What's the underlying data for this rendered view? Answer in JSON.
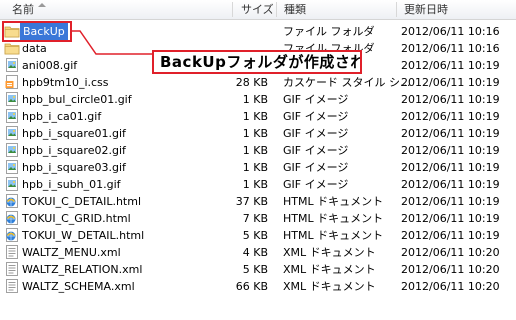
{
  "header": {
    "name": "名前",
    "size": "サイズ",
    "type": "種類",
    "modified": "更新日時"
  },
  "annotation": {
    "text": "BackUpフォルダが作成される",
    "color": "#e0202a"
  },
  "files": [
    {
      "name": "BackUp",
      "size": "",
      "type": "ファイル フォルダ",
      "modified": "2012/06/11 10:16",
      "icon": "folder-icon",
      "selected": true
    },
    {
      "name": "data",
      "size": "",
      "type": "ファイル フォルダ",
      "modified": "2012/06/11 10:16",
      "icon": "folder-icon"
    },
    {
      "name": "ani008.gif",
      "size": "",
      "type": "",
      "modified": "2012/06/11 10:19",
      "icon": "gif-image-icon"
    },
    {
      "name": "hpb9tm10_i.css",
      "size": "28 KB",
      "type": "カスケード スタイル シ...",
      "modified": "2012/06/11 10:19",
      "icon": "css-file-icon"
    },
    {
      "name": "hpb_bul_circle01.gif",
      "size": "1 KB",
      "type": "GIF イメージ",
      "modified": "2012/06/11 10:19",
      "icon": "gif-image-icon"
    },
    {
      "name": "hpb_i_ca01.gif",
      "size": "1 KB",
      "type": "GIF イメージ",
      "modified": "2012/06/11 10:19",
      "icon": "gif-image-icon"
    },
    {
      "name": "hpb_i_square01.gif",
      "size": "1 KB",
      "type": "GIF イメージ",
      "modified": "2012/06/11 10:19",
      "icon": "gif-image-icon"
    },
    {
      "name": "hpb_i_square02.gif",
      "size": "1 KB",
      "type": "GIF イメージ",
      "modified": "2012/06/11 10:19",
      "icon": "gif-image-icon"
    },
    {
      "name": "hpb_i_square03.gif",
      "size": "1 KB",
      "type": "GIF イメージ",
      "modified": "2012/06/11 10:19",
      "icon": "gif-image-icon"
    },
    {
      "name": "hpb_i_subh_01.gif",
      "size": "1 KB",
      "type": "GIF イメージ",
      "modified": "2012/06/11 10:19",
      "icon": "gif-image-icon"
    },
    {
      "name": "TOKUI_C_DETAIL.html",
      "size": "37 KB",
      "type": "HTML ドキュメント",
      "modified": "2012/06/11 10:19",
      "icon": "html-document-icon"
    },
    {
      "name": "TOKUI_C_GRID.html",
      "size": "7 KB",
      "type": "HTML ドキュメント",
      "modified": "2012/06/11 10:19",
      "icon": "html-document-icon"
    },
    {
      "name": "TOKUI_W_DETAIL.html",
      "size": "5 KB",
      "type": "HTML ドキュメント",
      "modified": "2012/06/11 10:19",
      "icon": "html-document-icon"
    },
    {
      "name": "WALTZ_MENU.xml",
      "size": "4 KB",
      "type": "XML ドキュメント",
      "modified": "2012/06/11 10:20",
      "icon": "xml-document-icon"
    },
    {
      "name": "WALTZ_RELATION.xml",
      "size": "5 KB",
      "type": "XML ドキュメント",
      "modified": "2012/06/11 10:20",
      "icon": "xml-document-icon"
    },
    {
      "name": "WALTZ_SCHEMA.xml",
      "size": "66 KB",
      "type": "XML ドキュメント",
      "modified": "2012/06/11 10:20",
      "icon": "xml-document-icon"
    }
  ]
}
